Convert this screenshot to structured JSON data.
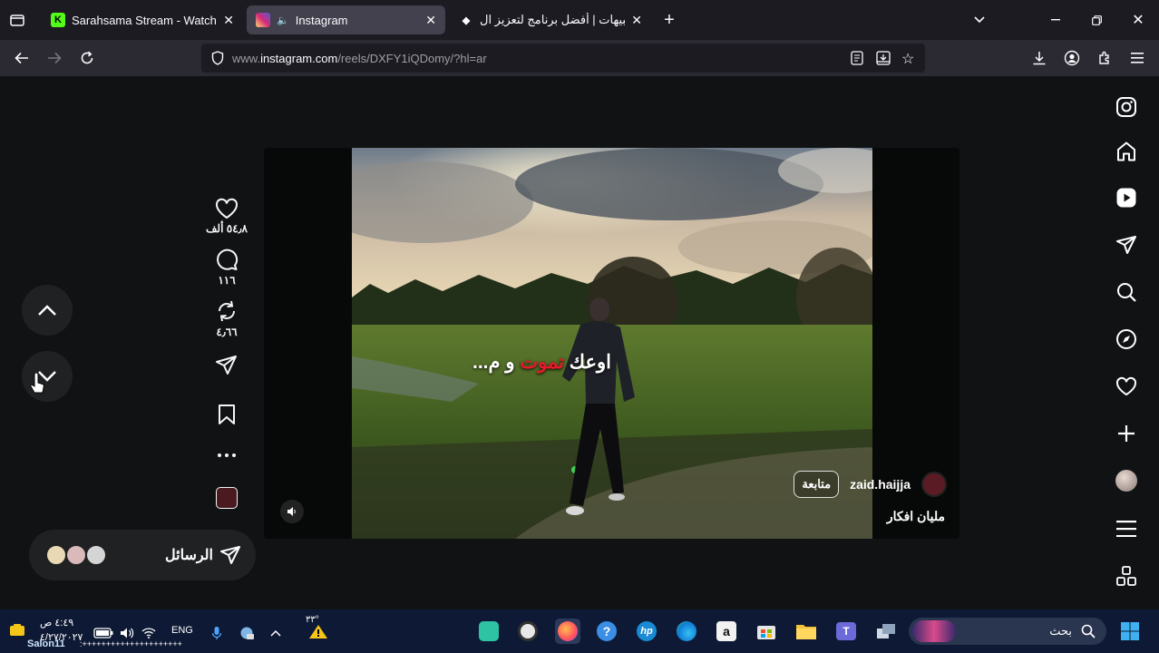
{
  "browser": {
    "tabs": [
      {
        "title": "Sarahsama Stream - Watch Live",
        "favicon": "kick-icon",
        "color": "#53fc18"
      },
      {
        "title": "Instagram",
        "favicon": "instagram-icon",
        "active": true
      },
      {
        "title": "التنبيهات | أفضل برنامج لتعزيز ال",
        "favicon": "diamond-icon"
      }
    ],
    "new_tab": "+",
    "url": {
      "prefix": "www.",
      "domain": "instagram.com",
      "rest": "/reels/DXFY1iQDomy/?hl=ar"
    }
  },
  "reel": {
    "likes": "٥٤٫٨ ألف",
    "comments": "١١٦",
    "reposts": "٤٫٦٦",
    "username": "zaid.haijja",
    "follow_label": "متابعة",
    "caption": "مليان افكار",
    "overlay_text_white_1": "اوعك ",
    "overlay_text_red": "تموت",
    "overlay_text_white_2": " و م..."
  },
  "messages": {
    "label": "الرسائل"
  },
  "taskbar": {
    "search_placeholder": "بحث",
    "language": "ENG",
    "time": "٤:٤٩ ص",
    "date": "٤/٢٧/٢٠٢٧",
    "weather": "٣٣°",
    "chat_user": "Salon11",
    "chat_text": ":+++++++++++++++++++++"
  },
  "colors": {
    "accent_red": "#e51a2a",
    "page_bg": "#101214",
    "chrome_bg": "#1c1b22",
    "taskbar_bg": "#0e1a35"
  }
}
